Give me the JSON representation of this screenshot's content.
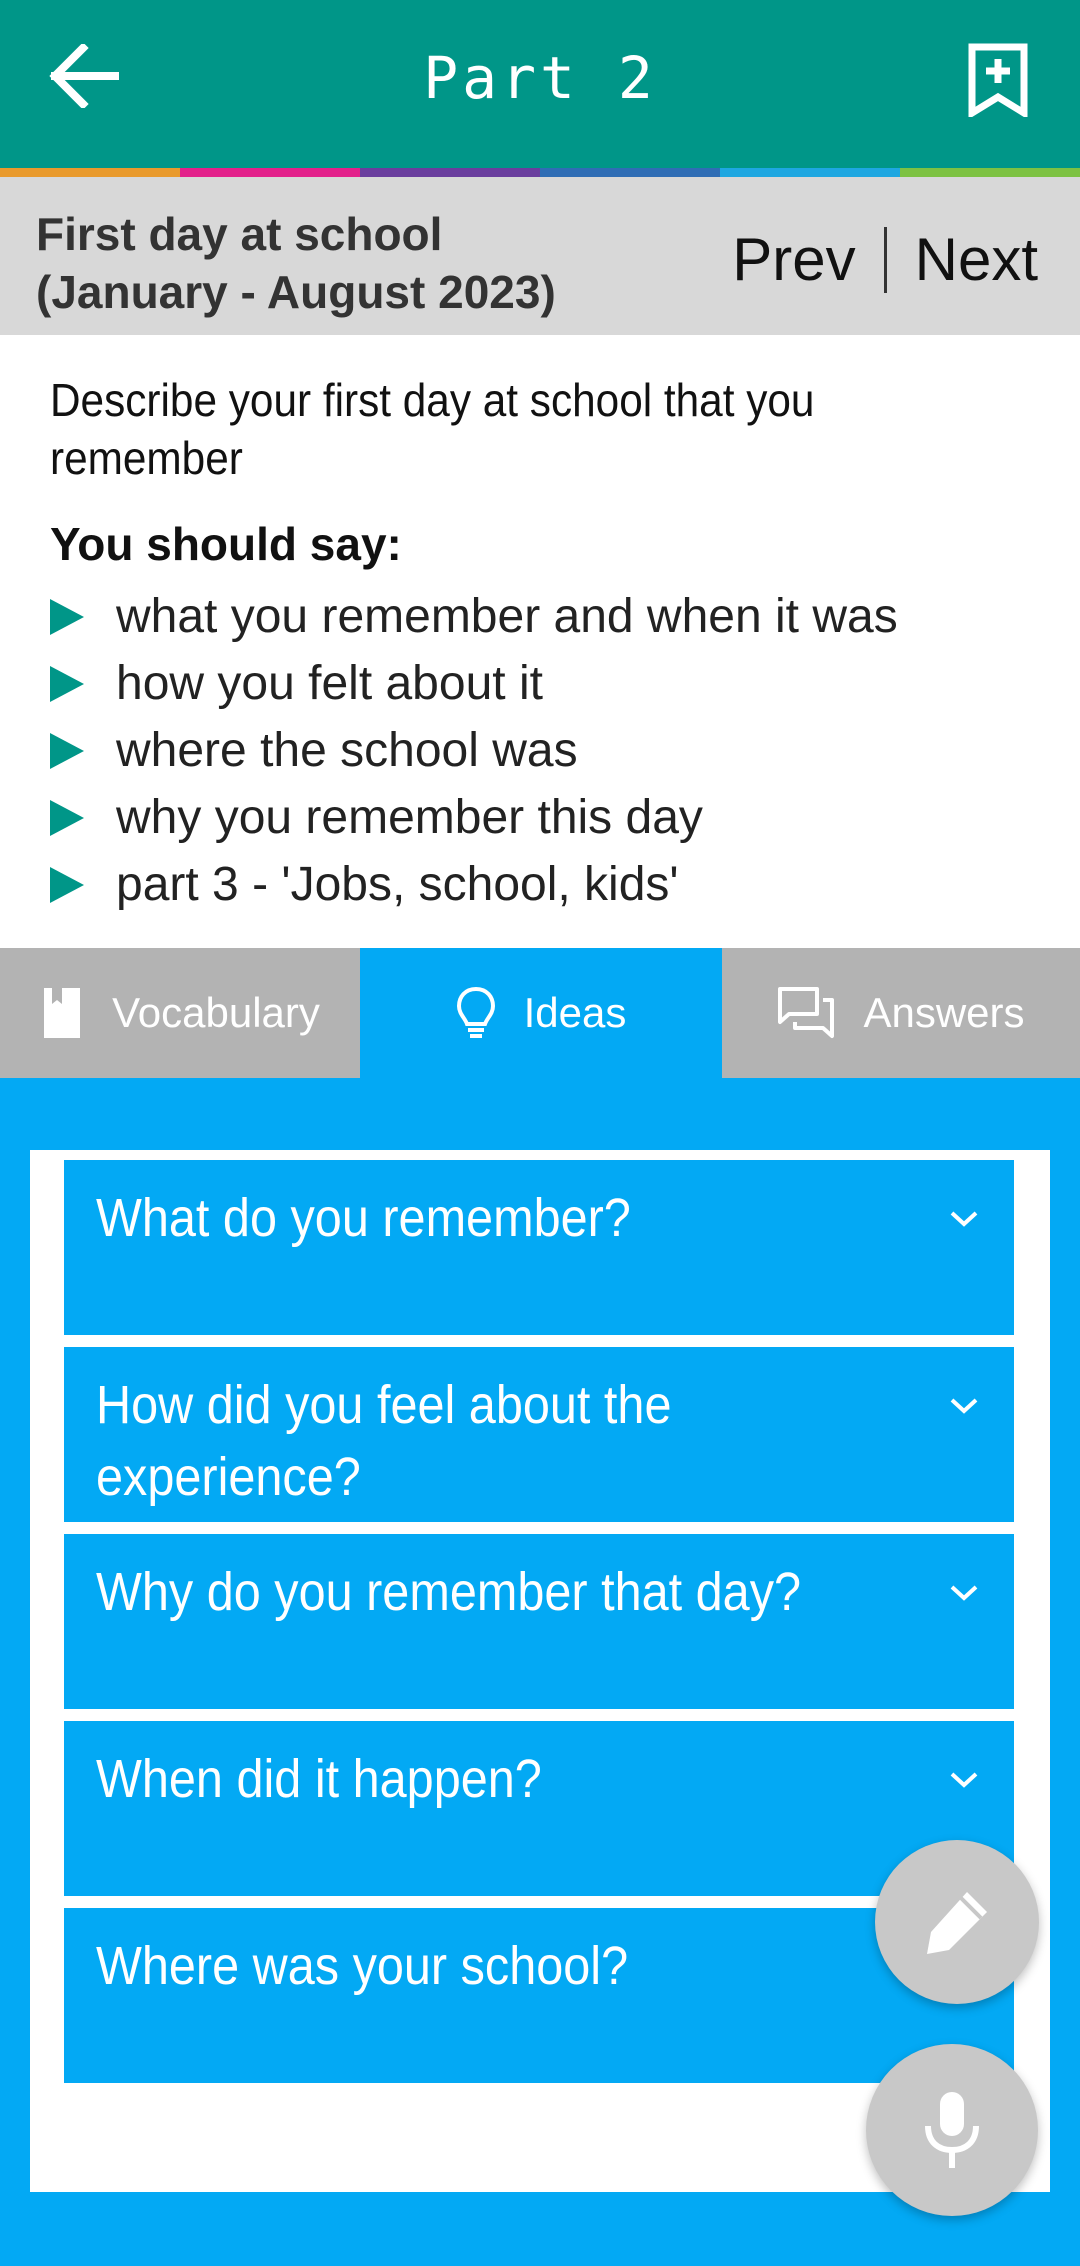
{
  "appbar": {
    "title": "Part 2",
    "back_icon": "arrow-left-icon",
    "bookmark_icon": "bookmark-plus-icon",
    "color": "#009688"
  },
  "stripe_colors": [
    "#E99A2C",
    "#E3218B",
    "#6A3E9E",
    "#2F6DB5",
    "#1EA7E1",
    "#7DC242"
  ],
  "subhead": {
    "topic_line1": "First day at school",
    "topic_line2": "(January - August 2023)",
    "prev_label": "Prev",
    "next_label": "Next"
  },
  "cue_card": {
    "description": "Describe your first day at school that you remember",
    "you_should_say": "You should say:",
    "points": [
      "what you remember and when it was",
      "how you felt about it",
      "where the school was",
      "why you remember this day",
      "part 3 - 'Jobs, school, kids'"
    ]
  },
  "tabs": [
    {
      "label": "Vocabulary",
      "icon": "book-icon",
      "active": false
    },
    {
      "label": "Ideas",
      "icon": "lightbulb-icon",
      "active": true
    },
    {
      "label": "Answers",
      "icon": "chat-bubbles-icon",
      "active": false
    }
  ],
  "ideas": [
    "What do you remember?",
    "How did you feel about the experience?",
    "Why do you remember that day?",
    "When did it happen?",
    "Where was your school?"
  ],
  "fabs": {
    "edit_icon": "pencil-icon",
    "mic_icon": "microphone-icon"
  }
}
